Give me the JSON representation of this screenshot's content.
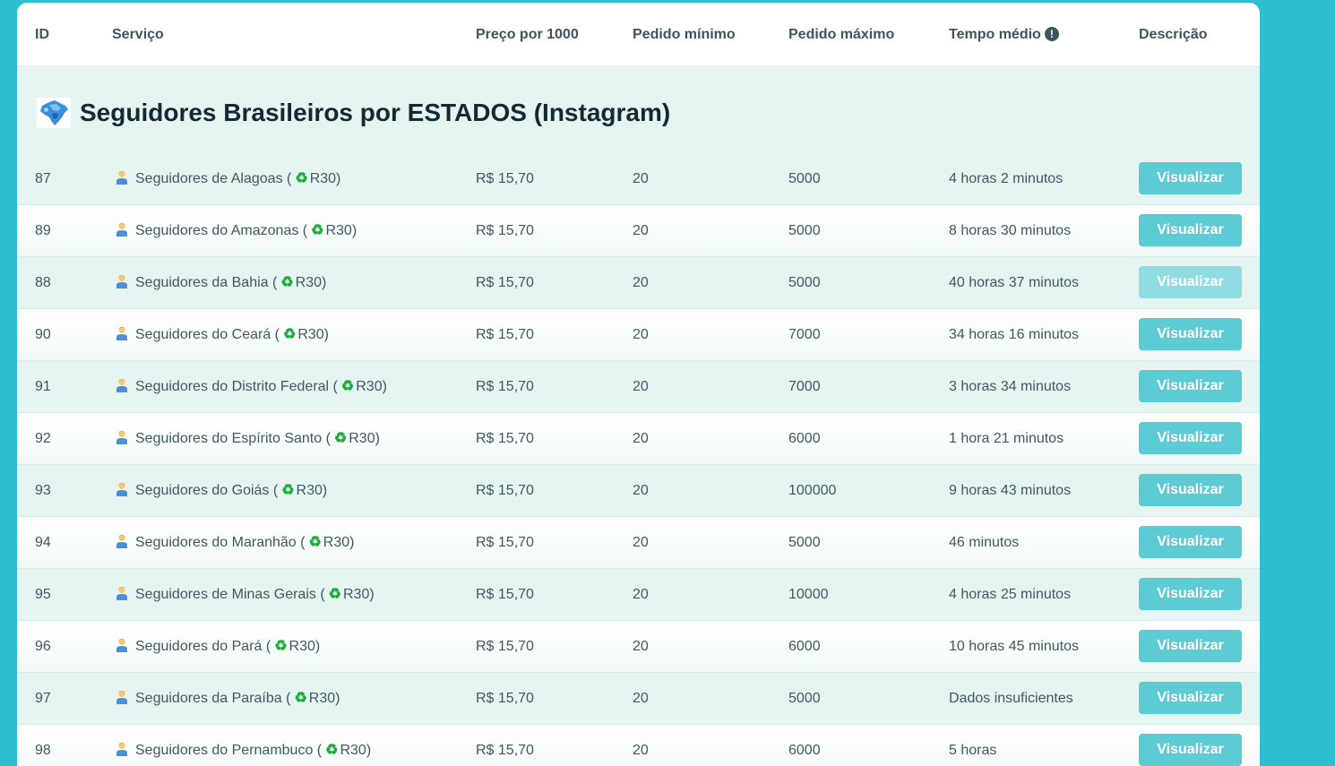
{
  "header": {
    "id": "ID",
    "service": "Serviço",
    "price": "Preço por 1000",
    "min": "Pedido mínimo",
    "max": "Pedido máximo",
    "avg_time": "Tempo médio",
    "description": "Descrição"
  },
  "category": {
    "title": "Seguidores Brasileiros por ESTADOS (Instagram)",
    "icon": "brazil-map-icon"
  },
  "colors": {
    "background": "#2fbfd2",
    "button": "#5ccbd4",
    "button_hover": "#8fdce2",
    "recycle": "#1ea83c"
  },
  "rows": [
    {
      "id": "87",
      "service": "Seguidores de Alagoas (",
      "tag": "R30)",
      "price": "R$ 15,70",
      "min": "20",
      "max": "5000",
      "time": "4 horas 2 minutos",
      "button": "Visualizar"
    },
    {
      "id": "89",
      "service": "Seguidores do Amazonas (",
      "tag": "R30)",
      "price": "R$ 15,70",
      "min": "20",
      "max": "5000",
      "time": "8 horas 30 minutos",
      "button": "Visualizar"
    },
    {
      "id": "88",
      "service": "Seguidores da Bahia (",
      "tag": "R30)",
      "price": "R$ 15,70",
      "min": "20",
      "max": "5000",
      "time": "40 horas 37 minutos",
      "button": "Visualizar"
    },
    {
      "id": "90",
      "service": "Seguidores do Ceará (",
      "tag": "R30)",
      "price": "R$ 15,70",
      "min": "20",
      "max": "7000",
      "time": "34 horas 16 minutos",
      "button": "Visualizar"
    },
    {
      "id": "91",
      "service": "Seguidores do Distrito Federal (",
      "tag": "R30)",
      "price": "R$ 15,70",
      "min": "20",
      "max": "7000",
      "time": "3 horas 34 minutos",
      "button": "Visualizar"
    },
    {
      "id": "92",
      "service": "Seguidores do Espírito Santo (",
      "tag": "R30)",
      "price": "R$ 15,70",
      "min": "20",
      "max": "6000",
      "time": "1 hora 21 minutos",
      "button": "Visualizar"
    },
    {
      "id": "93",
      "service": "Seguidores do Goiás (",
      "tag": "R30)",
      "price": "R$ 15,70",
      "min": "20",
      "max": "100000",
      "time": "9 horas 43 minutos",
      "button": "Visualizar"
    },
    {
      "id": "94",
      "service": "Seguidores do Maranhão (",
      "tag": "R30)",
      "price": "R$ 15,70",
      "min": "20",
      "max": "5000",
      "time": "46 minutos",
      "button": "Visualizar"
    },
    {
      "id": "95",
      "service": "Seguidores de Minas Gerais (",
      "tag": "R30)",
      "price": "R$ 15,70",
      "min": "20",
      "max": "10000",
      "time": "4 horas 25 minutos",
      "button": "Visualizar"
    },
    {
      "id": "96",
      "service": "Seguidores do Pará (",
      "tag": "R30)",
      "price": "R$ 15,70",
      "min": "20",
      "max": "6000",
      "time": "10 horas 45 minutos",
      "button": "Visualizar"
    },
    {
      "id": "97",
      "service": "Seguidores da Paraíba (",
      "tag": "R30)",
      "price": "R$ 15,70",
      "min": "20",
      "max": "5000",
      "time": "Dados insuficientes",
      "button": "Visualizar"
    },
    {
      "id": "98",
      "service": "Seguidores do Pernambuco (",
      "tag": "R30)",
      "price": "R$ 15,70",
      "min": "20",
      "max": "6000",
      "time": "5 horas",
      "button": "Visualizar"
    }
  ]
}
